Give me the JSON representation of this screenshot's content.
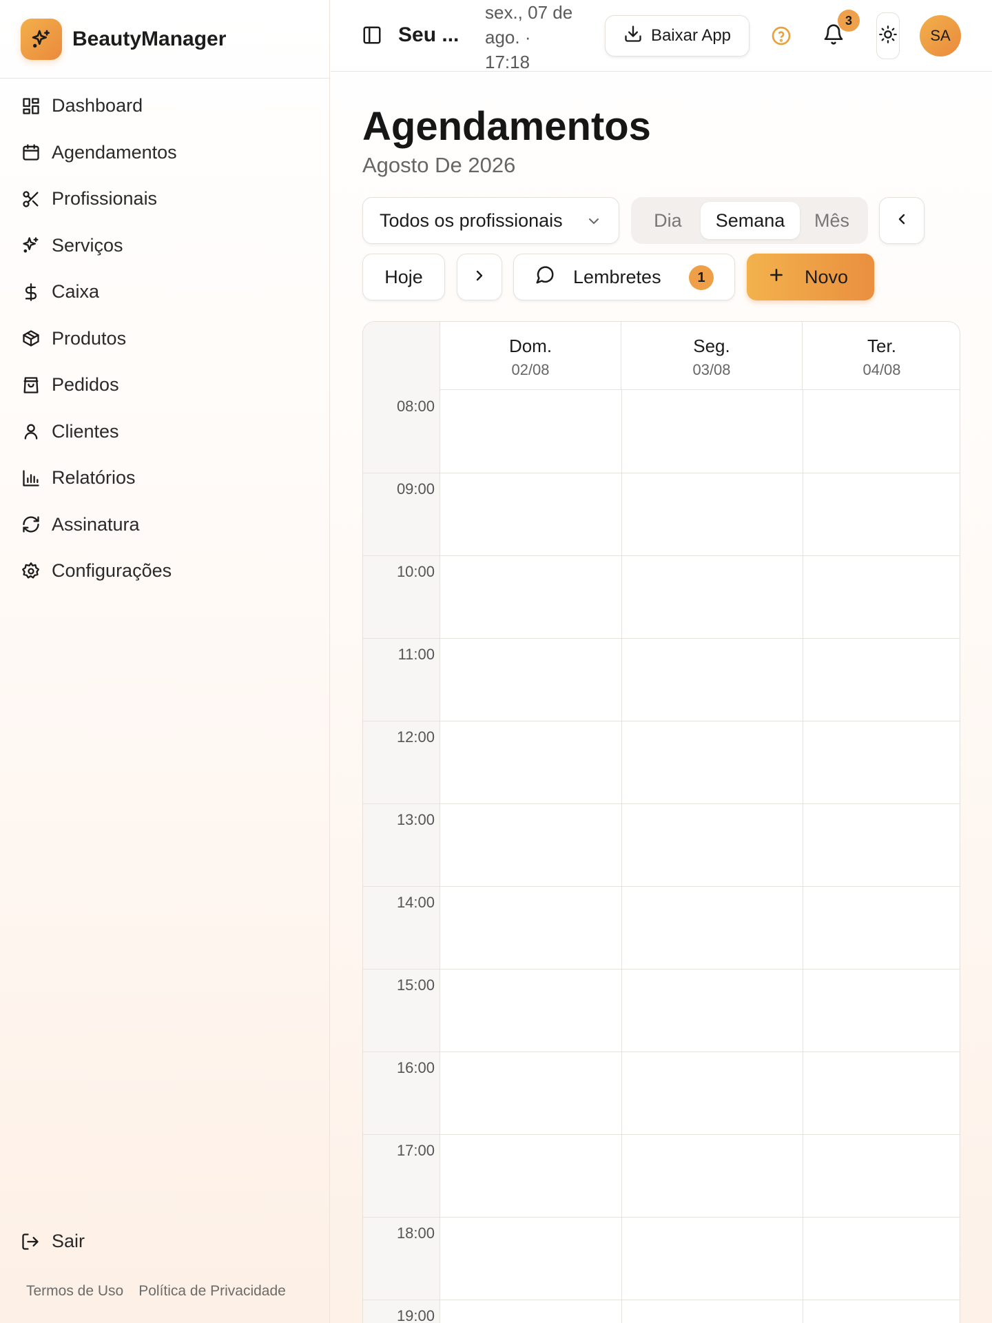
{
  "sidebar": {
    "brand": "BeautyManager",
    "items": [
      {
        "label": "Dashboard",
        "icon": "dashboard-icon"
      },
      {
        "label": "Agendamentos",
        "icon": "calendar-icon"
      },
      {
        "label": "Profissionais",
        "icon": "scissors-icon"
      },
      {
        "label": "Serviços",
        "icon": "sparkles-icon"
      },
      {
        "label": "Caixa",
        "icon": "dollar-icon"
      },
      {
        "label": "Produtos",
        "icon": "package-icon"
      },
      {
        "label": "Pedidos",
        "icon": "shopping-bag-icon"
      },
      {
        "label": "Clientes",
        "icon": "user-icon"
      },
      {
        "label": "Relatórios",
        "icon": "bar-chart-icon"
      },
      {
        "label": "Assinatura",
        "icon": "refresh-icon"
      },
      {
        "label": "Configurações",
        "icon": "gear-icon"
      }
    ],
    "logout": "Sair",
    "terms": "Termos de Uso",
    "privacy": "Política de Privacidade"
  },
  "topbar": {
    "title": "Seu ...",
    "date_line1": "sex., 07 de",
    "date_line2": "ago. ·",
    "date_line3": "17:18",
    "download_label": "Baixar App",
    "notification_count": "3",
    "avatar_initials": "SA"
  },
  "main": {
    "title": "Agendamentos",
    "subtitle": "Agosto De 2026",
    "professional_filter": "Todos os profissionais",
    "views": {
      "day": "Dia",
      "week": "Semana",
      "month": "Mês",
      "selected": "Semana"
    },
    "today_label": "Hoje",
    "reminders_label": "Lembretes",
    "reminders_count": "1",
    "new_label": "Novo"
  },
  "calendar": {
    "days": [
      {
        "name": "Dom.",
        "date": "02/08"
      },
      {
        "name": "Seg.",
        "date": "03/08"
      },
      {
        "name": "Ter.",
        "date": "04/08"
      }
    ],
    "hours": [
      "08:00",
      "09:00",
      "10:00",
      "11:00",
      "12:00",
      "13:00",
      "14:00",
      "15:00",
      "16:00",
      "17:00",
      "18:00",
      "19:00"
    ]
  },
  "colors": {
    "accent": "#ee9f47",
    "accent_light": "#f3b24d",
    "help": "#e8a23c"
  }
}
